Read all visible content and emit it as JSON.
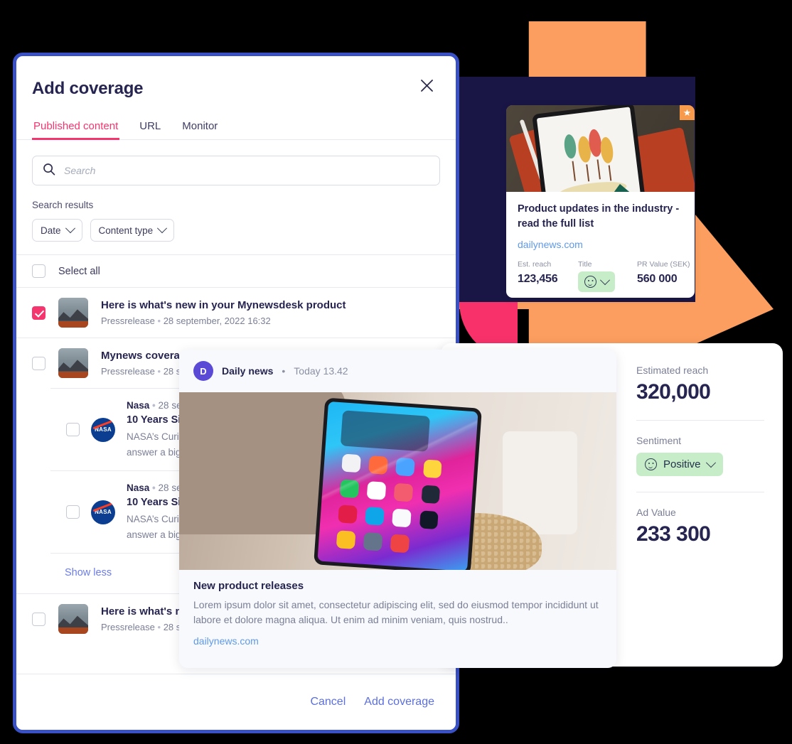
{
  "modal": {
    "title": "Add coverage",
    "close_icon": "close-icon",
    "tabs": [
      {
        "label": "Published content",
        "active": true
      },
      {
        "label": "URL",
        "active": false
      },
      {
        "label": "Monitor",
        "active": false
      }
    ],
    "search": {
      "placeholder": "Search",
      "value": "",
      "icon": "search-icon"
    },
    "results_label": "Search results",
    "filters": [
      {
        "label": "Date",
        "icon": "chevron-down-icon"
      },
      {
        "label": "Content type",
        "icon": "chevron-down-icon"
      }
    ],
    "select_all_label": "Select all",
    "rows": [
      {
        "title": "Here is what's new in your Mynewsdesk product",
        "type": "Pressrelease",
        "date": "28 september, 2022 16:32",
        "checked": true
      },
      {
        "title": "Mynews coverage",
        "type": "Pressrelease",
        "date": "28 se",
        "checked": false
      }
    ],
    "sub_rows": [
      {
        "source": "Nasa",
        "date": "28 septer",
        "title": "10 Years Since L",
        "desc_line1": "NASA’s Curiosity R",
        "desc_line2": "answer a big ques",
        "checked": false
      },
      {
        "source": "Nasa",
        "date": "28 septer",
        "title": "10 Years Since L",
        "desc_line1": "NASA’s Curiosity R",
        "desc_line2": "answer a big ques",
        "checked": false
      }
    ],
    "show_less_label": "Show less",
    "last_row": {
      "title": "Here is what's new",
      "type": "Pressrelease",
      "date": "28 se",
      "checked": false
    },
    "footer": {
      "cancel_label": "Cancel",
      "submit_label": "Add coverage"
    }
  },
  "card_small": {
    "badge_icon": "star-icon",
    "title": "Product updates in the industry - read the full list",
    "link": "dailynews.com",
    "stats": [
      {
        "key": "Est. reach",
        "value": "123,456"
      },
      {
        "key": "Title",
        "value": "",
        "pill": true,
        "icon": "smiley-icon",
        "chevron": "chevron-down-icon"
      },
      {
        "key": "PR Value (SEK)",
        "value": "560 000"
      }
    ]
  },
  "panel": {
    "metrics": [
      {
        "key": "Estimated reach",
        "value": "320,000"
      },
      {
        "key": "Sentiment",
        "pill_label": "Positive",
        "icon": "smiley-icon",
        "chevron": "chevron-down-icon"
      },
      {
        "key": "Ad Value",
        "value": "233 300"
      }
    ]
  },
  "feed": {
    "avatar_letter": "D",
    "source": "Daily news",
    "separator": "•",
    "time": "Today 13.42",
    "title": "New product releases",
    "description": "Lorem ipsum dolor sit amet, consectetur adipiscing elit, sed do eiusmod tempor incididunt ut labore et dolore magna aliqua. Ut enim ad minim veniam, quis nostrud..",
    "link": "dailynews.com"
  },
  "colors": {
    "accent_pink": "#f5356e",
    "link_blue": "#5b6fe0",
    "navy": "#191544",
    "orange": "#fb9e5f",
    "pink_circle": "#f8316a",
    "green_pill": "#c6edc8",
    "modal_border": "#3a51c6",
    "purple_avatar": "#5b4ad6"
  }
}
